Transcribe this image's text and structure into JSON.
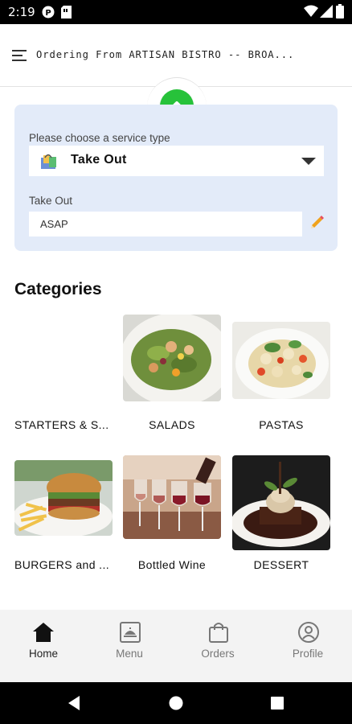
{
  "status_bar": {
    "time": "2:19",
    "icons": [
      "p-circle-icon",
      "sim-card-icon",
      "wifi-icon",
      "signal-icon",
      "battery-icon"
    ]
  },
  "header": {
    "menu_icon": "hamburger-menu-icon",
    "title": "Ordering From ARTISAN BISTRO -- BROA..."
  },
  "service": {
    "collapse_icon": "chevron-up-icon",
    "type_label": "Please choose a service type",
    "type_value": "Take Out",
    "type_icon": "shopping-bag-icon",
    "time_label": "Take Out",
    "time_value": "ASAP",
    "edit_icon": "pencil-icon"
  },
  "categories": {
    "title": "Categories",
    "items": [
      {
        "label": "STARTERS & S...",
        "image": "none"
      },
      {
        "label": "SALADS",
        "image": "salad-photo"
      },
      {
        "label": "PASTAS",
        "image": "pasta-photo"
      },
      {
        "label": "BURGERS and ...",
        "image": "burger-photo"
      },
      {
        "label": "Bottled Wine",
        "image": "wine-photo"
      },
      {
        "label": "DESSERT",
        "image": "dessert-photo"
      }
    ]
  },
  "bottom_nav": {
    "items": [
      {
        "label": "Home",
        "icon": "home-icon",
        "active": true
      },
      {
        "label": "Menu",
        "icon": "menu-book-icon",
        "active": false
      },
      {
        "label": "Orders",
        "icon": "shopping-bag-icon",
        "active": false
      },
      {
        "label": "Profile",
        "icon": "profile-icon",
        "active": false
      }
    ]
  },
  "colors": {
    "accent_green": "#27c23a",
    "panel_bg": "#e3ebf9",
    "pencil_orange": "#f0a21c"
  }
}
